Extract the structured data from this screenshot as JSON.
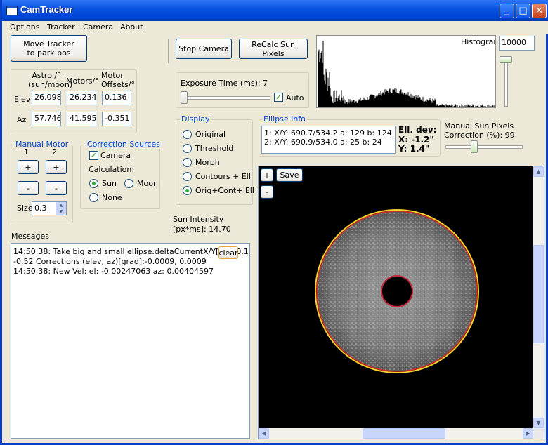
{
  "window": {
    "title": "CamTracker"
  },
  "menu": {
    "options": "Options",
    "tracker": "Tracker",
    "camera": "Camera",
    "about": "About"
  },
  "buttons": {
    "move_tracker_line1": "Move Tracker",
    "move_tracker_line2": "to park pos",
    "stop_camera": "Stop Camera",
    "recalc": "ReCalc Sun Pixels",
    "plus": "+",
    "minus": "-",
    "clear": "clear",
    "save": "Save"
  },
  "positions": {
    "astro_header_line1": "Astro /°",
    "astro_header_line2": "(sun/moon)",
    "motors_header": "Motors/°",
    "offsets_header_line1": "Motor",
    "offsets_header_line2": "Offsets/°",
    "elev_label": "Elev",
    "az_label": "Az",
    "elev_astro": "26.098",
    "elev_motors": "26.234",
    "elev_offset": "0.136",
    "az_astro": "57.746",
    "az_motors": "41.595",
    "az_offset": "-0.351"
  },
  "manual_motor": {
    "title": "Manual Motor",
    "col1": "1",
    "col2": "2",
    "size_label": "Size",
    "size_value": "0.3"
  },
  "correction": {
    "title": "Correction Sources",
    "camera_label": "Camera",
    "camera_checked": true,
    "calculation_label": "Calculation:",
    "sun": "Sun",
    "moon": "Moon",
    "none": "None",
    "selected": "Sun"
  },
  "exposure": {
    "label": "Exposure Time (ms): 7",
    "auto_label": "Auto",
    "auto_checked": true
  },
  "display": {
    "title": "Display",
    "options": [
      "Original",
      "Threshold",
      "Morph",
      "Contours + Ell",
      "Orig+Cont+ Ell"
    ],
    "selected": "Orig+Cont+ Ell"
  },
  "sun_intensity": {
    "line1": "Sun Intensity",
    "line2": "[px*ms]: 14.70"
  },
  "histogram": {
    "label": "Histogram",
    "max_value": "10000"
  },
  "ellipse": {
    "title": "Ellipse Info",
    "line1": "1: X/Y: 690.7/534.2 a: 129 b: 124",
    "line2": "2: X/Y: 690.9/534.0 a: 25 b: 24",
    "dev_title": "Ell. dev:",
    "dev_x": "X: -1.2\"",
    "dev_y": "Y: 1.4\""
  },
  "manual_sun": {
    "line1": "Manual Sun Pixels",
    "line2": "Correction (%): 99",
    "value": 99
  },
  "messages": {
    "title": "Messages",
    "lines": [
      "14:50:38: Take big and small ellipse.deltaCurrentX/Y[px]: 0.1",
      "-0.52  Corrections (elev, az)[grad]:-0.0009, 0.0009",
      "14:50:38: New Vel: el: -0.00247063 az: 0.00404597"
    ]
  },
  "icons": {
    "minimize": "minimize-icon",
    "maximize": "maximize-icon",
    "close": "close-icon"
  }
}
